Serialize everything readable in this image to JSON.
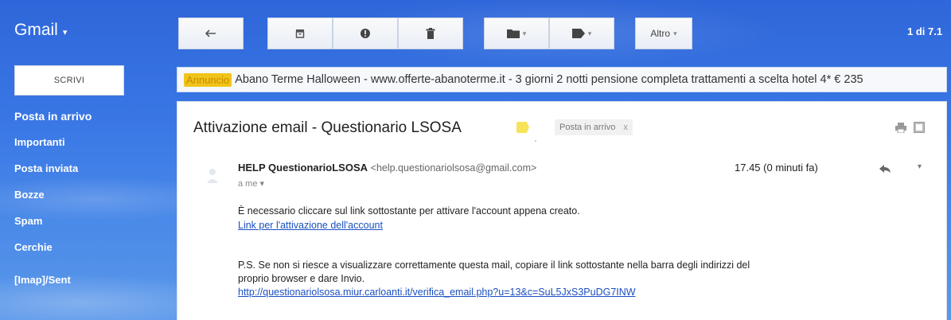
{
  "app": {
    "logo": "Gmail",
    "logo_caret": "▾"
  },
  "toolbar": {
    "back_icon": "back-arrow-icon",
    "archive_icon": "archive-icon",
    "spam_icon": "report-spam-icon",
    "delete_icon": "trash-icon",
    "move_icon": "folder-icon",
    "labels_icon": "label-icon",
    "more_label": "Altro",
    "dropdown_caret": "▾"
  },
  "pagination": {
    "counter": "1 di 7.1"
  },
  "compose_label": "SCRIVI",
  "sidebar": {
    "items": [
      {
        "label": "Posta in arrivo"
      },
      {
        "label": "Importanti"
      },
      {
        "label": "Posta inviata"
      },
      {
        "label": "Bozze"
      },
      {
        "label": "Spam"
      },
      {
        "label": "Cerchie"
      },
      {
        "label": "[Imap]/Sent"
      }
    ]
  },
  "ad": {
    "badge": "Annuncio",
    "text": "Abano Terme Halloween - www.offerte-abanoterme.it - 3 giorni 2 notti pensione completa trattamenti a scelta hotel 4* € 235"
  },
  "email": {
    "subject": "Attivazione email - Questionario LSOSA",
    "label_chip": "Posta in arrivo",
    "label_chip_close": "x",
    "sender_name": "HELP QuestionarioLSOSA",
    "sender_email": "<help.questionariolsosa@gmail.com>",
    "to": "a me",
    "to_caret": "▾",
    "time": "17.45 (0 minuti fa)",
    "body_line1": "È necessario cliccare sul link sottostante per attivare l'account appena creato.",
    "activation_link": "Link per l'attivazione dell'account",
    "body_ps1": "P.S. Se non si riesce a visualizzare correttamente questa mail, copiare il link sottostante nella barra degli indirizzi del",
    "body_ps2": "proprio browser e dare Invio.",
    "url": "http://questionariolsosa.miur.carloanti.it/verifica_email.php?u=13&c=SuL5JxS3PuDG7INW"
  },
  "colors": {
    "accent": "#3a78e6",
    "link": "#1a4fc0",
    "ad_badge": "#f0c419"
  }
}
